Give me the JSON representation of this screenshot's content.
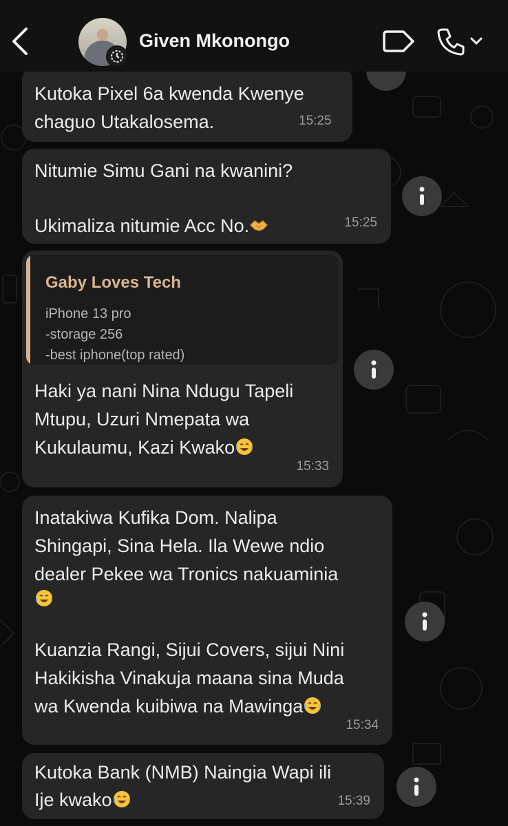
{
  "header": {
    "contact_name": "Given Mkonongo",
    "icons": [
      "chevron-left-icon",
      "status-ring-icon",
      "video-tag-icon",
      "phone-icon",
      "chevron-down-icon"
    ]
  },
  "colors": {
    "background": "#0b0b0b",
    "bubble": "#262626",
    "quote_accent": "#d9b48f",
    "timestamp": "#9a9a9a"
  },
  "messages": [
    {
      "text": "Kutoka Pixel 6a kwenda Kwenye\nchaguo Utakalosema.",
      "time": "15:25"
    },
    {
      "text_line1": "Nitumie Simu Gani na kwanini?",
      "text_line2": "Ukimaliza nitumie Acc No.",
      "emoji": "handshake",
      "time": "15:25"
    },
    {
      "quote": {
        "author": "Gaby Loves Tech",
        "lines": [
          "iPhone 13 pro",
          "-storage 256",
          "-best iphone(top rated)"
        ]
      },
      "text_line1": "Haki ya nani Nina Ndugu Tapeli",
      "text_line2": "Mtupu, Uzuri Nmepata wa",
      "text_line3": "Kukulaumu, Kazi Kwako",
      "emoji": "tears-of-joy",
      "time": "15:33"
    },
    {
      "text_line1": "Inatakiwa Kufika Dom. Nalipa",
      "text_line2": "Shingapi, Sina Hela. Ila Wewe ndio",
      "text_line3": "dealer Pekee wa Tronics nakuaminia",
      "text_line5": "Kuanzia Rangi, Sijui Covers, sijui Nini",
      "text_line6": "Hakikisha Vinakuja maana sina Muda",
      "text_line7": "wa Kwenda kuibiwa na Mawinga",
      "emoji": "tears-of-joy",
      "time": "15:34"
    },
    {
      "text_line1": "Kutoka Bank (NMB) Naingia Wapi ili",
      "text_line2": "Ije kwako",
      "emoji": "tears-of-joy",
      "time": "15:39"
    }
  ]
}
